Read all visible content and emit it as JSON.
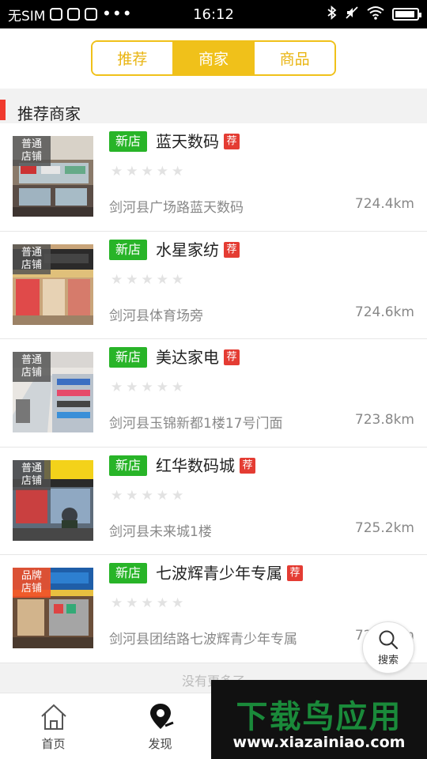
{
  "status_bar": {
    "carrier": "无SIM",
    "dots": "•••",
    "time": "16:12"
  },
  "tabs": [
    {
      "label": "推荐",
      "active": false
    },
    {
      "label": "商家",
      "active": true
    },
    {
      "label": "商品",
      "active": false
    }
  ],
  "section": {
    "title": "推荐商家"
  },
  "shops": [
    {
      "type": "普通店铺",
      "type_l1": "普通",
      "type_l2": "店铺",
      "badge": "新店",
      "name": "蓝天数码",
      "rec": "荐",
      "rating": 0,
      "address": "剑河县广场路蓝天数码",
      "distance": "724.4km"
    },
    {
      "type": "普通店铺",
      "type_l1": "普通",
      "type_l2": "店铺",
      "badge": "新店",
      "name": "水星家纺",
      "rec": "荐",
      "rating": 0,
      "address": "剑河县体育场旁",
      "distance": "724.6km"
    },
    {
      "type": "普通店铺",
      "type_l1": "普通",
      "type_l2": "店铺",
      "badge": "新店",
      "name": "美达家电",
      "rec": "荐",
      "rating": 0,
      "address": "剑河县玉锦新都1楼17号门面",
      "distance": "723.8km"
    },
    {
      "type": "普通店铺",
      "type_l1": "普通",
      "type_l2": "店铺",
      "badge": "新店",
      "name": "红华数码城",
      "rec": "荐",
      "rating": 0,
      "address": "剑河县未来城1楼",
      "distance": "725.2km"
    },
    {
      "type": "品牌店铺",
      "type_l1": "品牌",
      "type_l2": "店铺",
      "badge": "新店",
      "name": "七波辉青少年专属",
      "rec": "荐",
      "rating": 0,
      "address": "剑河县团结路七波辉青少年专属",
      "distance": "724.5km"
    }
  ],
  "no_more": "没有更多了",
  "search_fab": {
    "label": "搜索",
    "icon": "search-icon"
  },
  "bottom_nav": [
    {
      "label": "首页",
      "icon": "home-icon"
    },
    {
      "label": "发现",
      "icon": "location-pin-icon"
    }
  ],
  "watermark": {
    "main": "下载鸟应用",
    "url": "www.xiazainiao.com"
  },
  "colors": {
    "accent": "#f0c11a",
    "new_badge": "#28b428",
    "rec_badge": "#e43c33",
    "section_bar": "#f03a2e"
  }
}
